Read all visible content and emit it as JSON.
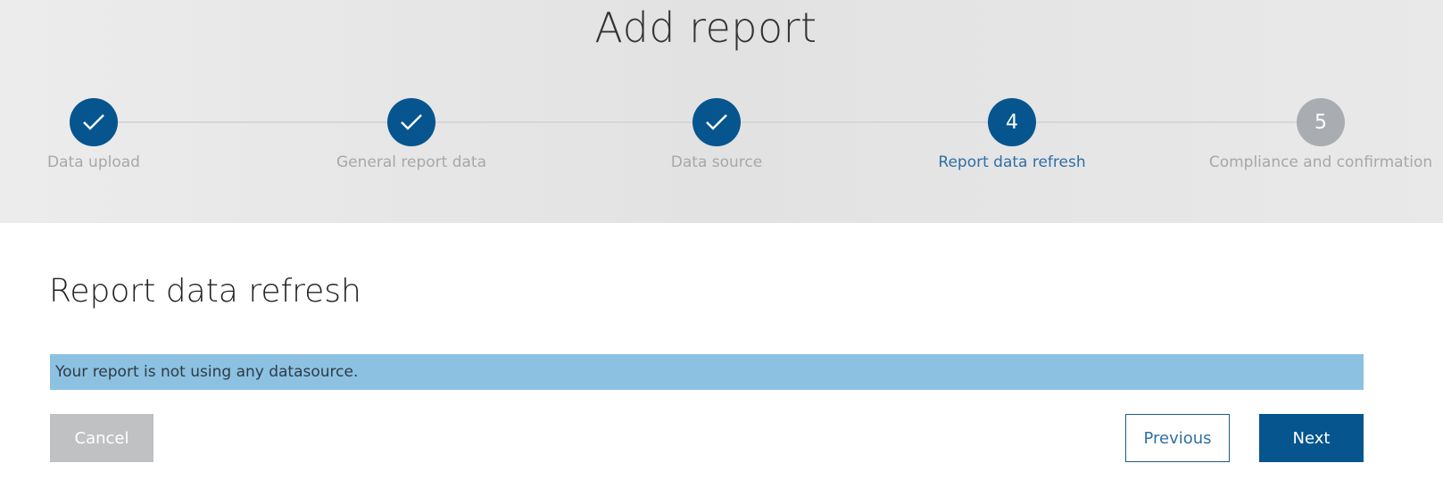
{
  "header": {
    "title": "Add report"
  },
  "stepper": {
    "steps": [
      {
        "number": "1",
        "label": "Data upload",
        "status": "completed",
        "icon": "check-icon"
      },
      {
        "number": "2",
        "label": "General report data",
        "status": "completed",
        "icon": "check-icon"
      },
      {
        "number": "3",
        "label": "Data source",
        "status": "completed",
        "icon": "check-icon"
      },
      {
        "number": "4",
        "label": "Report data refresh",
        "status": "active"
      },
      {
        "number": "5",
        "label": "Compliance and confirmation",
        "status": "pending"
      }
    ]
  },
  "section": {
    "title": "Report data refresh",
    "info_message": "Your report is not using any datasource."
  },
  "actions": {
    "cancel_label": "Cancel",
    "previous_label": "Previous",
    "next_label": "Next"
  },
  "colors": {
    "primary": "#06558f",
    "active_text": "#2f6fa5",
    "pending_circle": "#a9adb1",
    "info_banner": "#8cc1e1",
    "cancel_button": "#c0c1c3"
  }
}
